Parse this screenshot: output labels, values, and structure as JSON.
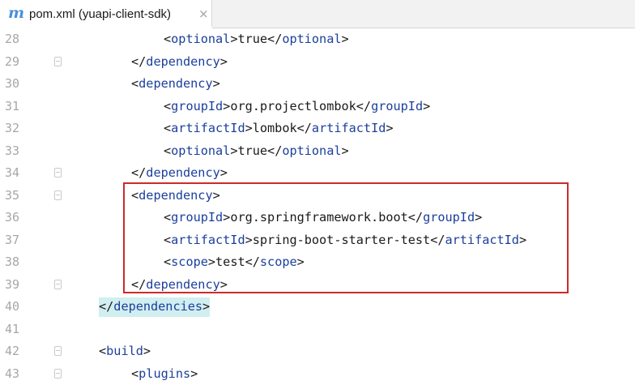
{
  "tab": {
    "icon": "maven-m-icon",
    "icon_glyph": "m",
    "title": "pom.xml (yuapi-client-sdk)",
    "close_glyph": "×"
  },
  "colors": {
    "tag": "#1b3f9c",
    "text": "#1a1a1a",
    "highlight": "#d1eef0",
    "annotation_box": "#cc2b2b",
    "line_number": "#a7a7a7"
  },
  "lines": [
    {
      "num": "28",
      "indent": 2,
      "open_bracket": "<",
      "tag": "optional",
      "close_bracket": ">",
      "text": "true",
      "end_open": "</",
      "end_tag": "optional",
      "end_close": ">",
      "fold": false
    },
    {
      "num": "29",
      "indent": 1,
      "open_bracket": "</",
      "tag": "dependency",
      "close_bracket": ">",
      "fold": true
    },
    {
      "num": "30",
      "indent": 1,
      "open_bracket": "<",
      "tag": "dependency",
      "close_bracket": ">",
      "fold": false
    },
    {
      "num": "31",
      "indent": 2,
      "open_bracket": "<",
      "tag": "groupId",
      "close_bracket": ">",
      "text": "org.projectlombok",
      "end_open": "</",
      "end_tag": "groupId",
      "end_close": ">",
      "fold": false
    },
    {
      "num": "32",
      "indent": 2,
      "open_bracket": "<",
      "tag": "artifactId",
      "close_bracket": ">",
      "text": "lombok",
      "end_open": "</",
      "end_tag": "artifactId",
      "end_close": ">",
      "fold": false
    },
    {
      "num": "33",
      "indent": 2,
      "open_bracket": "<",
      "tag": "optional",
      "close_bracket": ">",
      "text": "true",
      "end_open": "</",
      "end_tag": "optional",
      "end_close": ">",
      "fold": false
    },
    {
      "num": "34",
      "indent": 1,
      "open_bracket": "</",
      "tag": "dependency",
      "close_bracket": ">",
      "fold": true
    },
    {
      "num": "35",
      "indent": 1,
      "open_bracket": "<",
      "tag": "dependency",
      "close_bracket": ">",
      "fold": true
    },
    {
      "num": "36",
      "indent": 2,
      "open_bracket": "<",
      "tag": "groupId",
      "close_bracket": ">",
      "text": "org.springframework.boot",
      "end_open": "</",
      "end_tag": "groupId",
      "end_close": ">",
      "fold": false
    },
    {
      "num": "37",
      "indent": 2,
      "open_bracket": "<",
      "tag": "artifactId",
      "close_bracket": ">",
      "text": "spring-boot-starter-test",
      "end_open": "</",
      "end_tag": "artifactId",
      "end_close": ">",
      "fold": false
    },
    {
      "num": "38",
      "indent": 2,
      "open_bracket": "<",
      "tag": "scope",
      "close_bracket": ">",
      "text": "test",
      "end_open": "</",
      "end_tag": "scope",
      "end_close": ">",
      "fold": false
    },
    {
      "num": "39",
      "indent": 1,
      "open_bracket": "</",
      "tag": "dependency",
      "close_bracket": ">",
      "fold": true
    },
    {
      "num": "40",
      "indent": 0,
      "open_bracket": "</",
      "tag": "dependencies",
      "close_bracket": ">",
      "highlight": true,
      "fold": false
    },
    {
      "num": "41",
      "indent": 0,
      "fold": false
    },
    {
      "num": "42",
      "indent": 0,
      "open_bracket": "<",
      "tag": "build",
      "close_bracket": ">",
      "fold": true
    },
    {
      "num": "43",
      "indent": 1,
      "open_bracket": "<",
      "tag": "plugins",
      "close_bracket": ">",
      "fold": true
    }
  ]
}
